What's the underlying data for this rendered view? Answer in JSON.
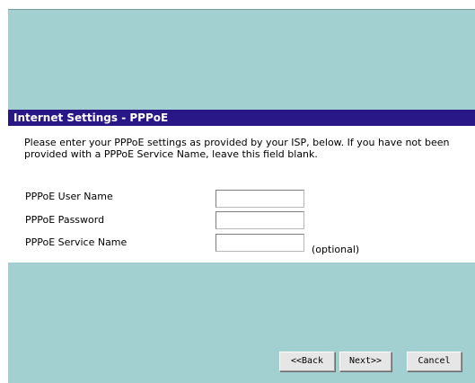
{
  "panel": {
    "title": "Internet Settings - PPPoE",
    "intro": "Please enter your PPPoE settings as provided by your ISP, below. If you have not been provided with a PPPoE Service Name, leave this field blank."
  },
  "fields": {
    "user_name": {
      "label": "PPPoE User Name",
      "value": ""
    },
    "password": {
      "label": "PPPoE Password",
      "value": ""
    },
    "service_name": {
      "label": "PPPoE Service Name",
      "value": "",
      "note": "(optional)"
    }
  },
  "buttons": {
    "back": "<<Back",
    "next": "Next>>",
    "cancel": "Cancel"
  },
  "colors": {
    "background": "#a2cfcf",
    "title_bar": "#2a1787",
    "title_text": "#ffffff",
    "panel": "#ffffff"
  }
}
